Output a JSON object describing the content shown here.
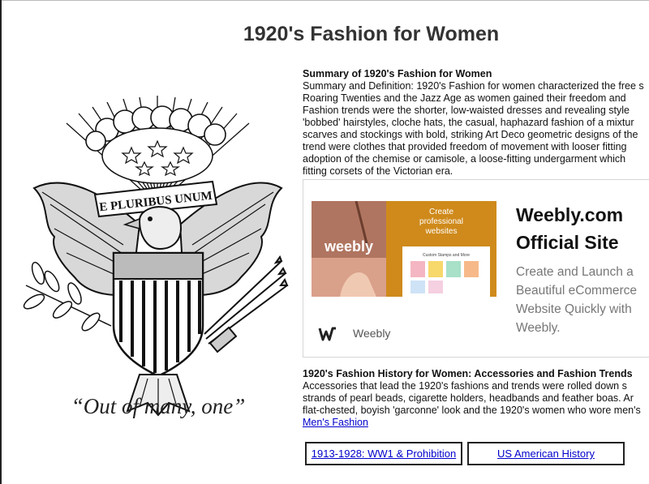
{
  "page": {
    "title": "1920's Fashion for Women"
  },
  "seal": {
    "motto_banner": "E PLURIBUS UNUM",
    "caption": "“Out of many, one”"
  },
  "summary": {
    "heading": "Summary of 1920's Fashion for Women",
    "lines": [
      "Summary and Definition: 1920's Fashion for women characterized the free s",
      "Roaring Twenties and the Jazz Age as women gained their freedom and",
      "Fashion trends were the shorter, low-waisted dresses and revealing  style",
      "'bobbed' hairstyles, cloche hats, the casual, haphazard fashion of a mixtur",
      "scarves and stockings with bold, striking Art Deco geometric designs of the",
      "trend were clothes that provided freedom of movement with looser fitting",
      "adoption of the chemise or camisole, a loose-fitting undergarment which",
      "fitting corsets of the Victorian era."
    ]
  },
  "ad": {
    "image_tagline": "Create professional websites",
    "image_logo": "weebly",
    "mock_site_title": "Custom Stamps and More",
    "headline_line1": "Weebly.com",
    "headline_line2": "Official Site",
    "description": "Create and Launch a Beautiful eCommerce Website Quickly with Weebly.",
    "brand_name": "Weebly",
    "colors": {
      "image_orange": "#cf8a1b",
      "description_gray": "#777777"
    }
  },
  "accessories": {
    "heading": "1920's Fashion History for Women: Accessories and Fashion Trends",
    "lines": [
      "Accessories that lead the 1920's fashions and trends were rolled down s",
      "strands of pearl beads, cigarette holders, headbands and feather boas. Ar",
      "flat-chested, boyish 'garconne' look and the 1920's women who wore men's"
    ],
    "link": "Men's Fashion"
  },
  "nav_buttons": {
    "ww1": "1913-1928: WW1 & Prohibition",
    "us_history": "US American History"
  },
  "colors": {
    "link": "#0000cc",
    "title": "#333333"
  }
}
